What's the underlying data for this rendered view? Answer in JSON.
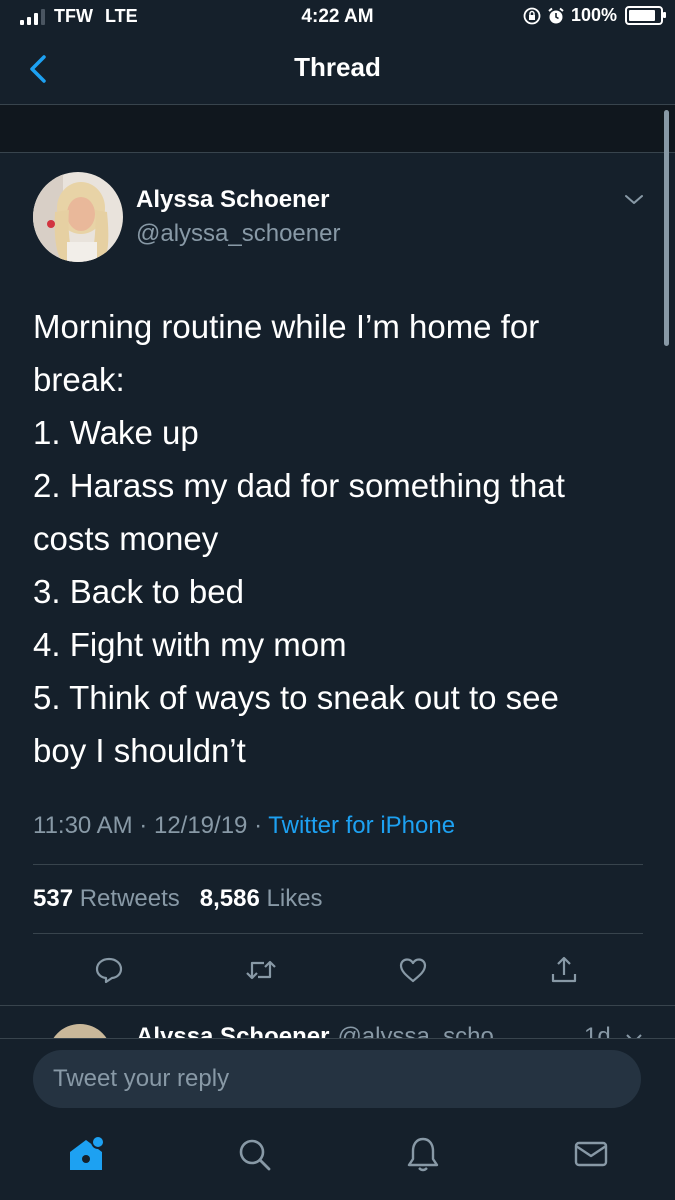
{
  "status_bar": {
    "carrier": "TFW",
    "network": "LTE",
    "time": "4:22 AM",
    "battery": "100%",
    "battery_level": 1.0,
    "signal_bars": 3
  },
  "nav": {
    "title": "Thread",
    "back_icon": "chevron-left-icon"
  },
  "tweet": {
    "author_name": "Alyssa Schoener",
    "author_handle": "@alyssa_schoener",
    "lines": [
      "Morning routine while I’m home for",
      "break:",
      "1. Wake up",
      "2. Harass my dad for something that",
      "costs money",
      "3. Back to bed",
      "4. Fight with my mom",
      "5. Think of ways to sneak out to see",
      "boy I shouldn’t"
    ],
    "time": "11:30 AM",
    "date": "12/19/19",
    "separator": "·",
    "source": "Twitter for iPhone",
    "retweets_count": "537",
    "retweets_label": "Retweets",
    "likes_count": "8,586",
    "likes_label": "Likes"
  },
  "next_tweet": {
    "author_name": "Alyssa Schoener",
    "author_handle": "@alyssa_scho...",
    "time": "1d"
  },
  "reply": {
    "placeholder": "Tweet your reply"
  },
  "tabs": [
    "home-icon",
    "search-icon",
    "notifications-icon",
    "messages-icon"
  ],
  "colors": {
    "background": "#15202b",
    "accent": "#1da1f2",
    "secondary_text": "#8899a6",
    "divider": "#38444d"
  }
}
